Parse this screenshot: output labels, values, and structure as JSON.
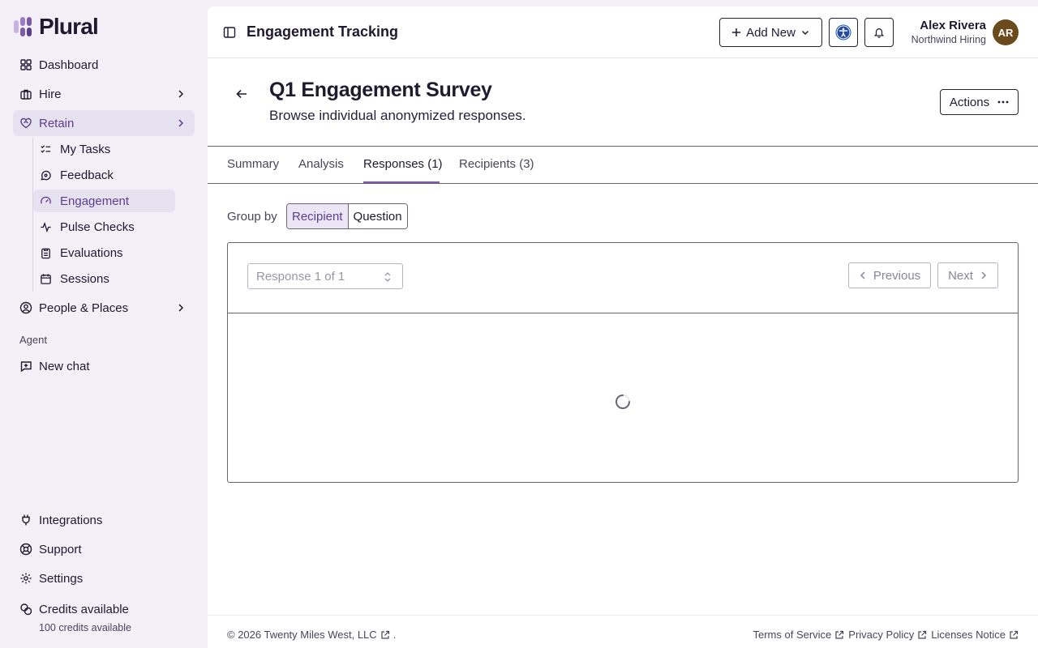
{
  "brand": {
    "name": "Plural"
  },
  "colors": {
    "accent": "#7c5aa8",
    "active_bg": "#e7e2f0",
    "sidebar_bg": "#f3f0f8",
    "avatar_bg": "#6b4a1e"
  },
  "sidebar": {
    "nav": {
      "dashboard": "Dashboard",
      "hire": "Hire",
      "retain": "Retain",
      "people": "People & Places"
    },
    "retain_sub": {
      "tasks": "My Tasks",
      "feedback": "Feedback",
      "engagement": "Engagement",
      "pulse": "Pulse Checks",
      "evaluations": "Evaluations",
      "sessions": "Sessions"
    },
    "agent_section": "Agent",
    "new_chat": "New chat",
    "bottom": {
      "integrations": "Integrations",
      "support": "Support",
      "settings": "Settings",
      "credits": "Credits available",
      "credits_sub": "100 credits available"
    }
  },
  "topbar": {
    "title": "Engagement Tracking",
    "add_new": "Add New",
    "user_name": "Alex Rivera",
    "user_org": "Northwind Hiring",
    "avatar_initials": "AR"
  },
  "page": {
    "title": "Q1 Engagement Survey",
    "description": "Browse individual anonymized responses.",
    "actions": "Actions"
  },
  "tabs": {
    "summary": "Summary",
    "analysis": "Analysis",
    "responses": "Responses (1)",
    "recipients": "Recipients (3)",
    "active": "responses"
  },
  "group_by": {
    "label": "Group by",
    "recipient": "Recipient",
    "question": "Question",
    "selected": "recipient"
  },
  "response_viewer": {
    "selector": "Response 1 of 1",
    "previous": "Previous",
    "next": "Next",
    "state": "loading"
  },
  "footer": {
    "copyright": "© 2026 Twenty Miles West, LLC",
    "period": ".",
    "terms": "Terms of Service",
    "privacy": "Privacy Policy",
    "licenses": "Licenses Notice"
  }
}
